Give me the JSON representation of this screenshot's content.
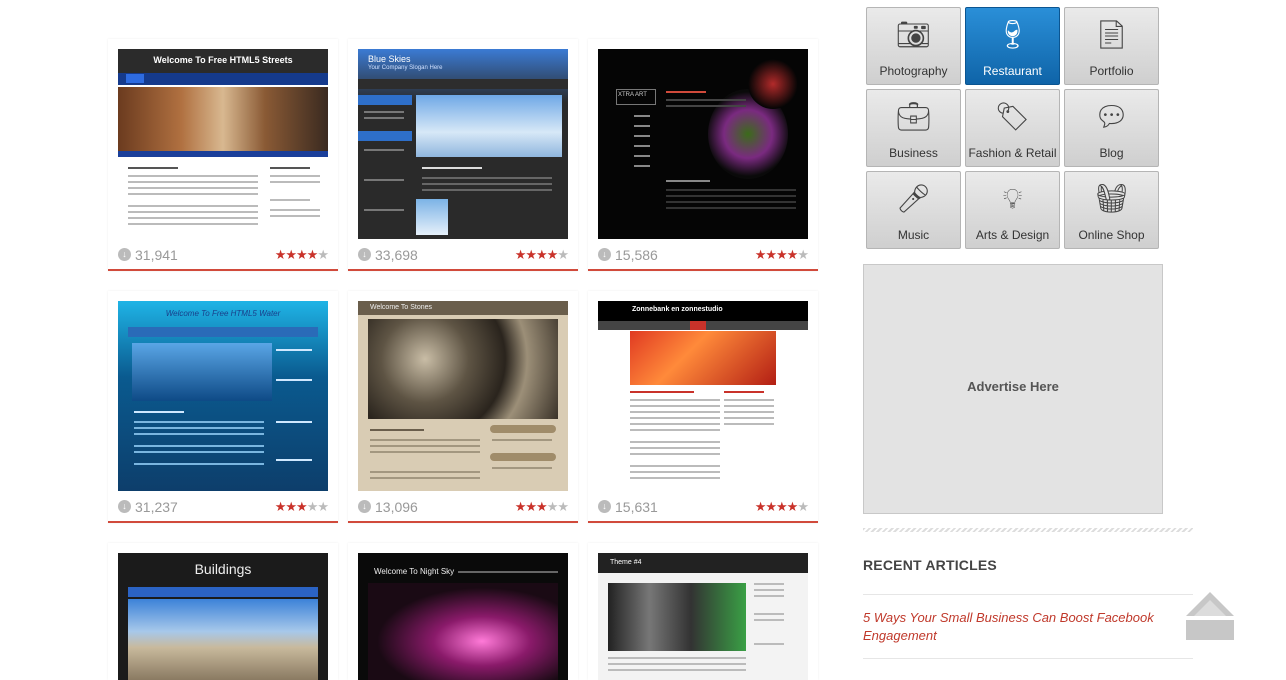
{
  "templates": [
    {
      "downloads": "31,941",
      "rating": 4,
      "title": "Welcome To Free HTML5 Streets"
    },
    {
      "downloads": "33,698",
      "rating": 4,
      "title": "Blue Skies",
      "slogan": "Your Company Slogan Here"
    },
    {
      "downloads": "15,586",
      "rating": 4,
      "title": "XTRA ART"
    },
    {
      "downloads": "31,237",
      "rating": 3,
      "title": "Welcome To Free HTML5 Water"
    },
    {
      "downloads": "13,096",
      "rating": 3,
      "title": "Welcome To Stones"
    },
    {
      "downloads": "15,631",
      "rating": 4,
      "title": "Zonnebank en zonnestudio"
    },
    {
      "title": "Buildings"
    },
    {
      "title": "Welcome To Night Sky"
    },
    {
      "title": "Theme #4"
    }
  ],
  "categories": [
    {
      "label": "Photography",
      "icon": "camera-icon"
    },
    {
      "label": "Restaurant",
      "icon": "wine-glasses-icon",
      "active": true
    },
    {
      "label": "Portfolio",
      "icon": "cv-document-icon"
    },
    {
      "label": "Business",
      "icon": "briefcase-icon"
    },
    {
      "label": "Fashion & Retail",
      "icon": "price-tag-icon"
    },
    {
      "label": "Blog",
      "icon": "speech-bubbles-icon"
    },
    {
      "label": "Music",
      "icon": "microphone-icon"
    },
    {
      "label": "Arts & Design",
      "icon": "lightbulb-icon"
    },
    {
      "label": "Online Shop",
      "icon": "shopping-basket-icon"
    }
  ],
  "advert": {
    "label": "Advertise Here"
  },
  "recent": {
    "heading": "RECENT ARTICLES",
    "articles": [
      "5 Ways Your Small Business Can Boost Facebook Engagement"
    ]
  },
  "colors": {
    "accent": "#d14a3b",
    "active_tile": "#1574c2",
    "link": "#c0392b"
  }
}
